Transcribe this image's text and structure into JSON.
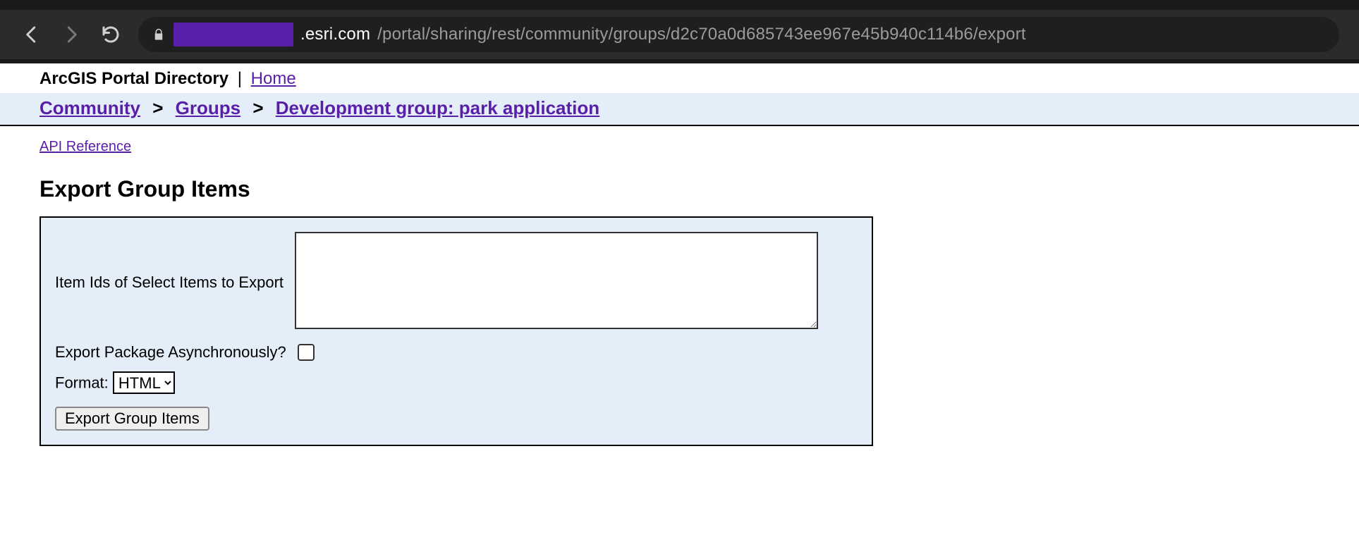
{
  "browser": {
    "url_host": ".esri.com",
    "url_path": "/portal/sharing/rest/community/groups/d2c70a0d685743ee967e45b940c114b6/export"
  },
  "header": {
    "directory_label": "ArcGIS Portal Directory",
    "separator": " | ",
    "home_label": "Home"
  },
  "breadcrumb": {
    "items": [
      "Community",
      "Groups",
      "Development group: park application"
    ],
    "separator": ">"
  },
  "links": {
    "api_reference": "API Reference"
  },
  "page_title": "Export Group Items",
  "form": {
    "item_ids_label": "Item Ids of Select Items to Export",
    "item_ids_value": "",
    "async_label": "Export Package Asynchronously?",
    "async_checked": false,
    "format_label": "Format:",
    "format_selected": "HTML",
    "submit_label": "Export Group Items"
  }
}
